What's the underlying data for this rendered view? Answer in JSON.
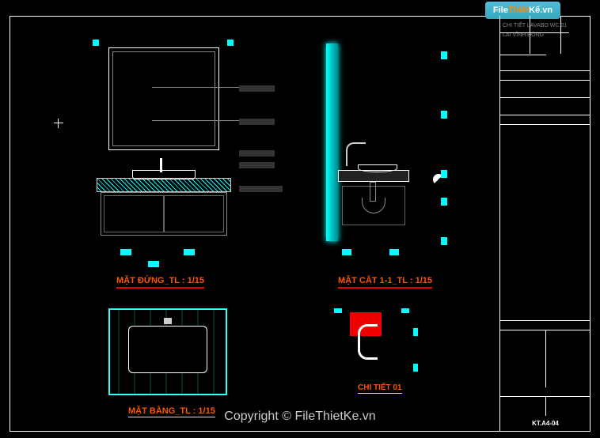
{
  "watermark": {
    "logo_left": "File",
    "logo_mid": "Thiết",
    "logo_right": "Kế",
    "domain": ".vn",
    "copyright": "Copyright © FileThietKe.vn"
  },
  "views": {
    "elevation_label": "MẶT ĐỨNG_TL : 1/15",
    "section_label": "MẶT CẮT 1-1_TL : 1/15",
    "plan_label": "MẶT BẰNG_TL : 1/15",
    "detail_label": "CHI TIẾT 01"
  },
  "titleblock": {
    "project_label": "LẠI VĨNH ĐÔNG",
    "drawing_title": "CHI TIẾT LAVABO WC 01",
    "sheet_no": "KT.A4-04"
  }
}
